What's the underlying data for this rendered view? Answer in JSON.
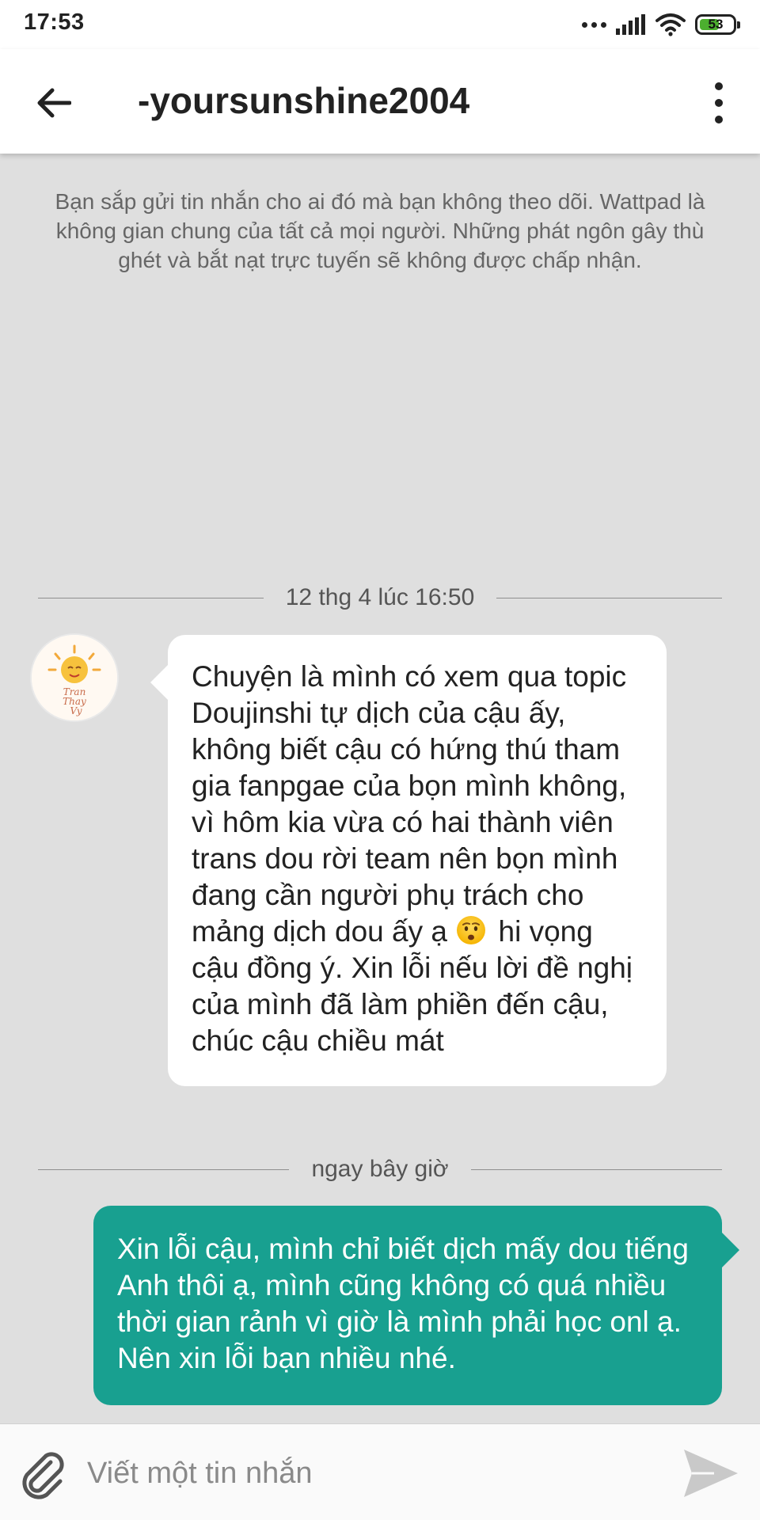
{
  "status_bar": {
    "time": "17:53",
    "battery": "53"
  },
  "header": {
    "title": "-yoursunshine2004"
  },
  "notice": "Bạn sắp gửi tin nhắn cho ai đó mà bạn không theo dõi. Wattpad là không gian chung của tất cả mọi người. Những phát ngôn gây thù ghét và bắt nạt trực tuyến sẽ không được chấp nhận.",
  "conversation": {
    "timestamp_1": "12 thg 4 lúc 16:50",
    "received": {
      "text_before_emoji": "Chuyện là mình có xem qua topic Doujinshi tự dịch của cậu ấy, không biết cậu có hứng thú tham gia fanpgae của bọn mình không, vì hôm kia vừa có hai thành viên trans dou rời team nên bọn mình đang cần người phụ trách cho mảng dịch dou ấy ạ",
      "emoji": "worried-face",
      "text_after_emoji": "hi vọng cậu đồng ý. Xin lỗi nếu lời đề nghị của mình đã làm phiền đến cậu, chúc cậu chiều mát"
    },
    "timestamp_2": "ngay bây giờ",
    "sent": {
      "text": "Xin lỗi cậu, mình chỉ biết dịch mấy dou tiếng Anh thôi ạ, mình cũng không có quá nhiều thời gian rảnh vì giờ là mình phải học onl ạ. Nên xin lỗi bạn nhiều nhé."
    }
  },
  "composer": {
    "placeholder": "Viết một tin nhắn"
  },
  "colors": {
    "sent_bubble": "#18a090",
    "background": "#dfdfdf"
  }
}
